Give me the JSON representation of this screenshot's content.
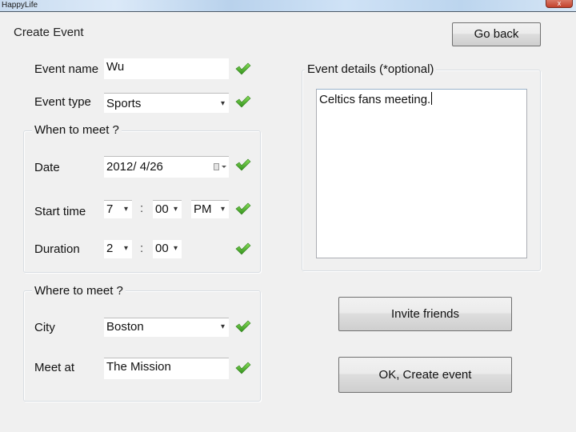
{
  "window": {
    "title": "HappyLife",
    "close_label": "x"
  },
  "page": {
    "heading": "Create Event",
    "go_back_label": "Go back"
  },
  "form": {
    "event_name": {
      "label": "Event name",
      "value": "Wu",
      "valid": true
    },
    "event_type": {
      "label": "Event type",
      "value": "Sports",
      "valid": true
    },
    "when_group": {
      "title": "When to meet ?",
      "date": {
        "label": "Date",
        "value": "2012/  4/26",
        "valid": true
      },
      "start_time": {
        "label": "Start time",
        "hour": "7",
        "minute": "00",
        "ampm": "PM",
        "separator": ":",
        "valid": true
      },
      "duration": {
        "label": "Duration",
        "hours": "2",
        "minutes": "00",
        "separator": ":",
        "valid": true
      }
    },
    "where_group": {
      "title": "Where to meet ?",
      "city": {
        "label": "City",
        "value": "Boston",
        "valid": true
      },
      "meet_at": {
        "label": "Meet at",
        "value": "The Mission",
        "valid": true
      }
    },
    "details_group": {
      "title": "Event details (*optional)",
      "value": "Celtics fans meeting."
    }
  },
  "actions": {
    "invite_label": "Invite friends",
    "create_label": "OK, Create event"
  },
  "icons": {
    "valid": "green-checkmark",
    "dropdown": "chevron-down",
    "calendar": "calendar"
  },
  "colors": {
    "check_green": "#4caf2a",
    "background": "#f0f0f0"
  }
}
